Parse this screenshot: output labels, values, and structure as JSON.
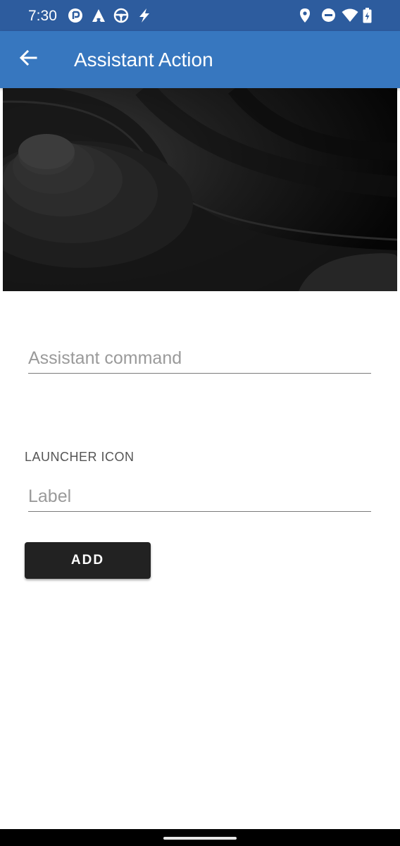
{
  "status_bar": {
    "time": "7:30",
    "left_icons": [
      "notification-app-icon",
      "assistant-a-icon",
      "steering-wheel-icon",
      "bolt-icon"
    ],
    "right_icons": [
      "location-pin-icon",
      "do-not-disturb-icon",
      "wifi-icon",
      "battery-charging-icon"
    ]
  },
  "app_bar": {
    "back_icon": "arrow-back-icon",
    "title": "Assistant Action",
    "background_color": "#3777bf"
  },
  "hero": {
    "description_icon": "dark-abstract-wallpaper-image"
  },
  "form": {
    "assistant_command_placeholder": "Assistant command",
    "launcher_icon_label": "LAUNCHER ICON",
    "label_placeholder": "Label",
    "add_button_label": "ADD"
  },
  "colors": {
    "status_bar": "#2d5c9e",
    "button": "#222222"
  }
}
